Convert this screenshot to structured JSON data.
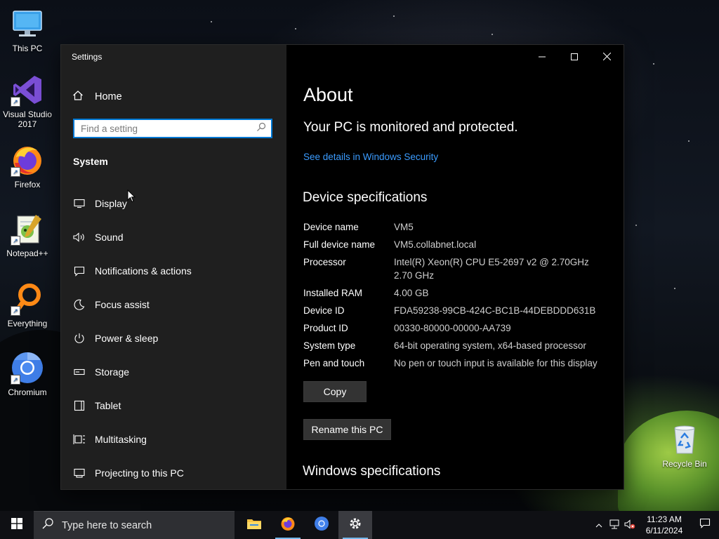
{
  "desktop": {
    "icons": [
      {
        "label": "This PC",
        "icon": "monitor-icon"
      },
      {
        "label": "Visual Studio 2017",
        "icon": "visual-studio-icon"
      },
      {
        "label": "Firefox",
        "icon": "firefox-icon"
      },
      {
        "label": "Notepad++",
        "icon": "notepad-plus-plus-icon"
      },
      {
        "label": "Everything",
        "icon": "everything-search-icon"
      },
      {
        "label": "Chromium",
        "icon": "chromium-icon"
      },
      {
        "label": "Recycle Bin",
        "icon": "recycle-bin-icon"
      }
    ]
  },
  "window": {
    "title": "Settings",
    "controls": {
      "minimize": "—",
      "maximize": "☐",
      "close": "✕"
    }
  },
  "nav": {
    "home_label": "Home",
    "search_placeholder": "Find a setting",
    "section_title": "System",
    "items": [
      {
        "label": "Display",
        "icon": "monitor-icon"
      },
      {
        "label": "Sound",
        "icon": "speaker-icon"
      },
      {
        "label": "Notifications & actions",
        "icon": "message-icon"
      },
      {
        "label": "Focus assist",
        "icon": "moon-icon"
      },
      {
        "label": "Power & sleep",
        "icon": "power-icon"
      },
      {
        "label": "Storage",
        "icon": "drive-icon"
      },
      {
        "label": "Tablet",
        "icon": "tablet-icon"
      },
      {
        "label": "Multitasking",
        "icon": "multitasking-icon"
      },
      {
        "label": "Projecting to this PC",
        "icon": "projector-icon"
      }
    ]
  },
  "about": {
    "title": "About",
    "protection_status": "Your PC is monitored and protected.",
    "security_link": "See details in Windows Security",
    "device_spec_heading": "Device specifications",
    "specs": [
      {
        "key": "Device name",
        "value": "VM5"
      },
      {
        "key": "Full device name",
        "value": "VM5.collabnet.local"
      },
      {
        "key": "Processor",
        "value": "Intel(R) Xeon(R) CPU E5-2697 v2 @ 2.70GHz 2.70 GHz"
      },
      {
        "key": "Installed RAM",
        "value": "4.00 GB"
      },
      {
        "key": "Device ID",
        "value": "FDA59238-99CB-424C-BC1B-44DEBDDD631B"
      },
      {
        "key": "Product ID",
        "value": "00330-80000-00000-AA739"
      },
      {
        "key": "System type",
        "value": "64-bit operating system, x64-based processor"
      },
      {
        "key": "Pen and touch",
        "value": "No pen or touch input is available for this display"
      }
    ],
    "copy_button": "Copy",
    "rename_button": "Rename this PC",
    "windows_spec_heading": "Windows specifications"
  },
  "taskbar": {
    "search_placeholder": "Type here to search",
    "pinned": [
      {
        "name": "file-explorer-icon",
        "state": "closed"
      },
      {
        "name": "firefox-icon",
        "state": "open"
      },
      {
        "name": "chromium-icon",
        "state": "closed"
      },
      {
        "name": "settings-icon",
        "state": "active"
      }
    ],
    "clock": {
      "time": "11:23 AM",
      "date": "6/11/2024"
    }
  },
  "colors": {
    "accent": "#0078d4",
    "link": "#3b9cff",
    "nav_bg": "#1f1f1f",
    "content_bg": "#000000",
    "taskbar_bg": "#0f1014"
  }
}
